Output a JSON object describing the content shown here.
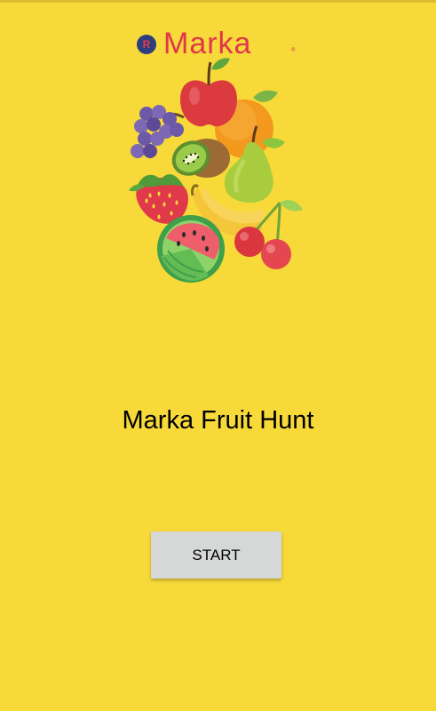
{
  "logo": {
    "badge": "R",
    "text": "Marka",
    "registered": "®"
  },
  "illustration": {
    "icon": "fruit-basket-illustration"
  },
  "title": "Marka Fruit Hunt",
  "start_label": "START",
  "colors": {
    "background": "#F7D93A",
    "button": "#D6D7D7",
    "brand": "#E0364A"
  }
}
